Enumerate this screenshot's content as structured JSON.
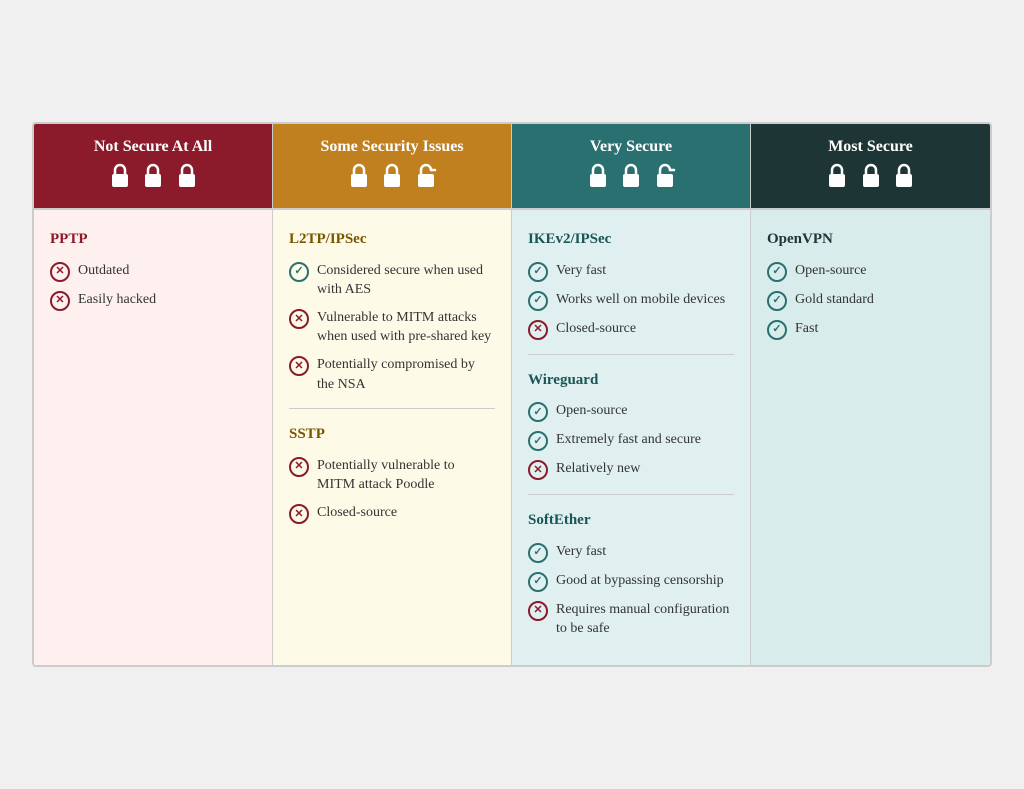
{
  "headers": [
    {
      "label": "Not Secure At All",
      "lockIcons": "🔒🔒🔒",
      "lockDisplay": "closed-closed-closed",
      "colorClass": "col-red",
      "bgClass": "cell-red-bg"
    },
    {
      "label": "Some Security Issues",
      "lockIcons": "🔒🔒🔓",
      "lockDisplay": "closed-closed-open",
      "colorClass": "col-amber",
      "bgClass": "cell-amber-bg"
    },
    {
      "label": "Very Secure",
      "lockIcons": "🔒🔒🔓",
      "lockDisplay": "closed-closed-open",
      "colorClass": "col-teal",
      "bgClass": "cell-teal-bg"
    },
    {
      "label": "Most Secure",
      "lockIcons": "🔒🔒🔒",
      "lockDisplay": "closed-closed-closed",
      "colorClass": "col-dark",
      "bgClass": "cell-dark-bg"
    }
  ],
  "columns": [
    {
      "sections": [
        {
          "protocol": "PPTP",
          "protocolColor": "red",
          "features": [
            {
              "type": "cross",
              "text": "Outdated"
            },
            {
              "type": "cross",
              "text": "Easily hacked"
            }
          ]
        }
      ]
    },
    {
      "sections": [
        {
          "protocol": "L2TP/IPSec",
          "protocolColor": "amber",
          "features": [
            {
              "type": "check",
              "text": "Considered secure when used with AES"
            },
            {
              "type": "cross",
              "text": "Vulnerable to MITM attacks when used with pre-shared key"
            },
            {
              "type": "cross",
              "text": "Potentially compromised by the NSA"
            }
          ]
        },
        {
          "protocol": "SSTP",
          "protocolColor": "amber",
          "features": [
            {
              "type": "cross",
              "text": "Potentially vulnerable to MITM attack Poodle"
            },
            {
              "type": "cross",
              "text": "Closed-source"
            }
          ]
        }
      ]
    },
    {
      "sections": [
        {
          "protocol": "IKEv2/IPSec",
          "protocolColor": "teal",
          "features": [
            {
              "type": "check",
              "text": "Very fast"
            },
            {
              "type": "check",
              "text": "Works well on mobile devices"
            },
            {
              "type": "cross",
              "text": "Closed-source"
            }
          ]
        },
        {
          "protocol": "Wireguard",
          "protocolColor": "teal",
          "features": [
            {
              "type": "check",
              "text": "Open-source"
            },
            {
              "type": "check",
              "text": "Extremely fast and secure"
            },
            {
              "type": "cross",
              "text": "Relatively new"
            }
          ]
        },
        {
          "protocol": "SoftEther",
          "protocolColor": "teal",
          "features": [
            {
              "type": "check",
              "text": "Very fast"
            },
            {
              "type": "check",
              "text": "Good at bypassing censorship"
            },
            {
              "type": "cross",
              "text": "Requires manual configuration to be safe"
            }
          ]
        }
      ]
    },
    {
      "sections": [
        {
          "protocol": "OpenVPN",
          "protocolColor": "dark",
          "features": [
            {
              "type": "check",
              "text": "Open-source"
            },
            {
              "type": "check",
              "text": "Gold standard"
            },
            {
              "type": "check",
              "text": "Fast"
            }
          ]
        }
      ]
    }
  ],
  "icons": {
    "check": "✓",
    "cross": "✕"
  }
}
